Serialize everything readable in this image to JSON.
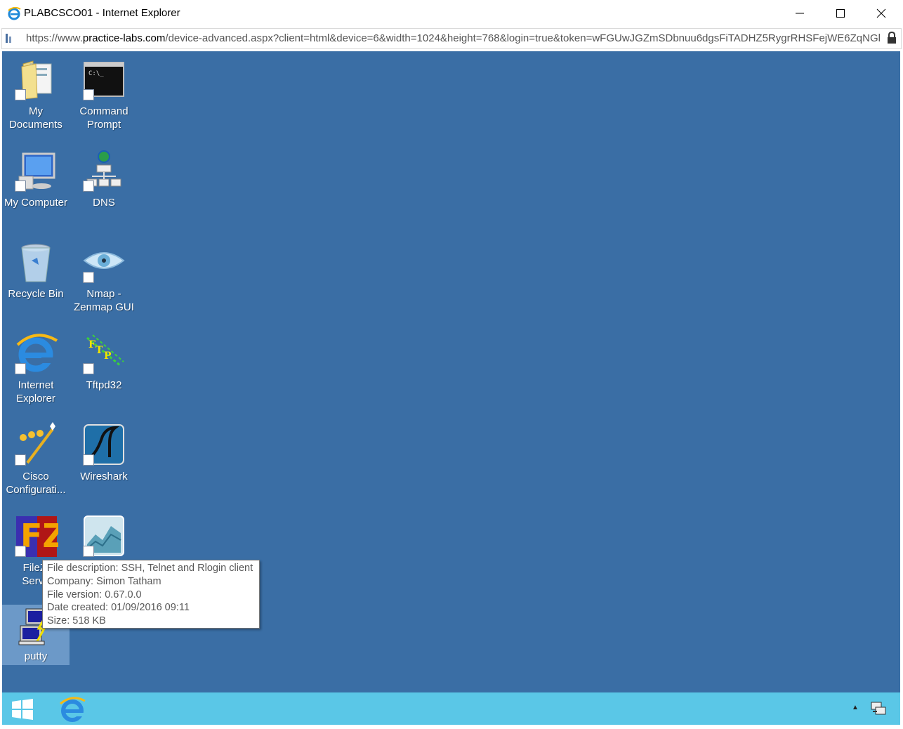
{
  "window": {
    "title": "PLABCSCO01 - Internet Explorer",
    "controls": [
      "minimize",
      "maximize",
      "close"
    ]
  },
  "address": {
    "url_prefix": "https://www.",
    "url_domain": "practice-labs.com",
    "url_rest": "/device-advanced.aspx?client=html&device=6&width=1024&height=768&login=true&token=wFGUwJGZmSDbnuu6dgsFiTADHZ5RygrRHSFejWE6ZqNGl"
  },
  "desktop": {
    "icons": [
      {
        "label1": "My",
        "label2": "Documents",
        "icon": "folder-icon"
      },
      {
        "label1": "Command",
        "label2": "Prompt",
        "icon": "cmd-icon"
      },
      {
        "label1": "My Computer",
        "label2": "",
        "icon": "computer-icon"
      },
      {
        "label1": "DNS",
        "label2": "",
        "icon": "dns-icon"
      },
      {
        "label1": "Recycle Bin",
        "label2": "",
        "icon": "recycle-bin-icon"
      },
      {
        "label1": "Nmap -",
        "label2": "Zenmap GUI",
        "icon": "nmap-icon"
      },
      {
        "label1": "Internet",
        "label2": "Explorer",
        "icon": "ie-icon"
      },
      {
        "label1": "Tftpd32",
        "label2": "",
        "icon": "tftpd-icon"
      },
      {
        "label1": "Cisco",
        "label2": "Configurati...",
        "icon": "cisco-config-icon"
      },
      {
        "label1": "Wireshark",
        "label2": "",
        "icon": "wireshark-icon"
      },
      {
        "label1": "FileZi",
        "label2": "Serve",
        "icon": "filezilla-icon"
      },
      {
        "label1": "",
        "label2": "",
        "icon": "graph-app-icon"
      },
      {
        "label1": "putty",
        "label2": "",
        "icon": "putty-icon"
      }
    ]
  },
  "tooltip": {
    "line1": "File description: SSH, Telnet and Rlogin client",
    "line2": "Company: Simon Tatham",
    "line3": "File version: 0.67.0.0",
    "line4": "Date created: 01/09/2016 09:11",
    "line5": "Size: 518 KB"
  },
  "colors": {
    "desktop": "#3a6ea5",
    "taskbar": "#5ac7e7",
    "selection": "#96bee6"
  }
}
